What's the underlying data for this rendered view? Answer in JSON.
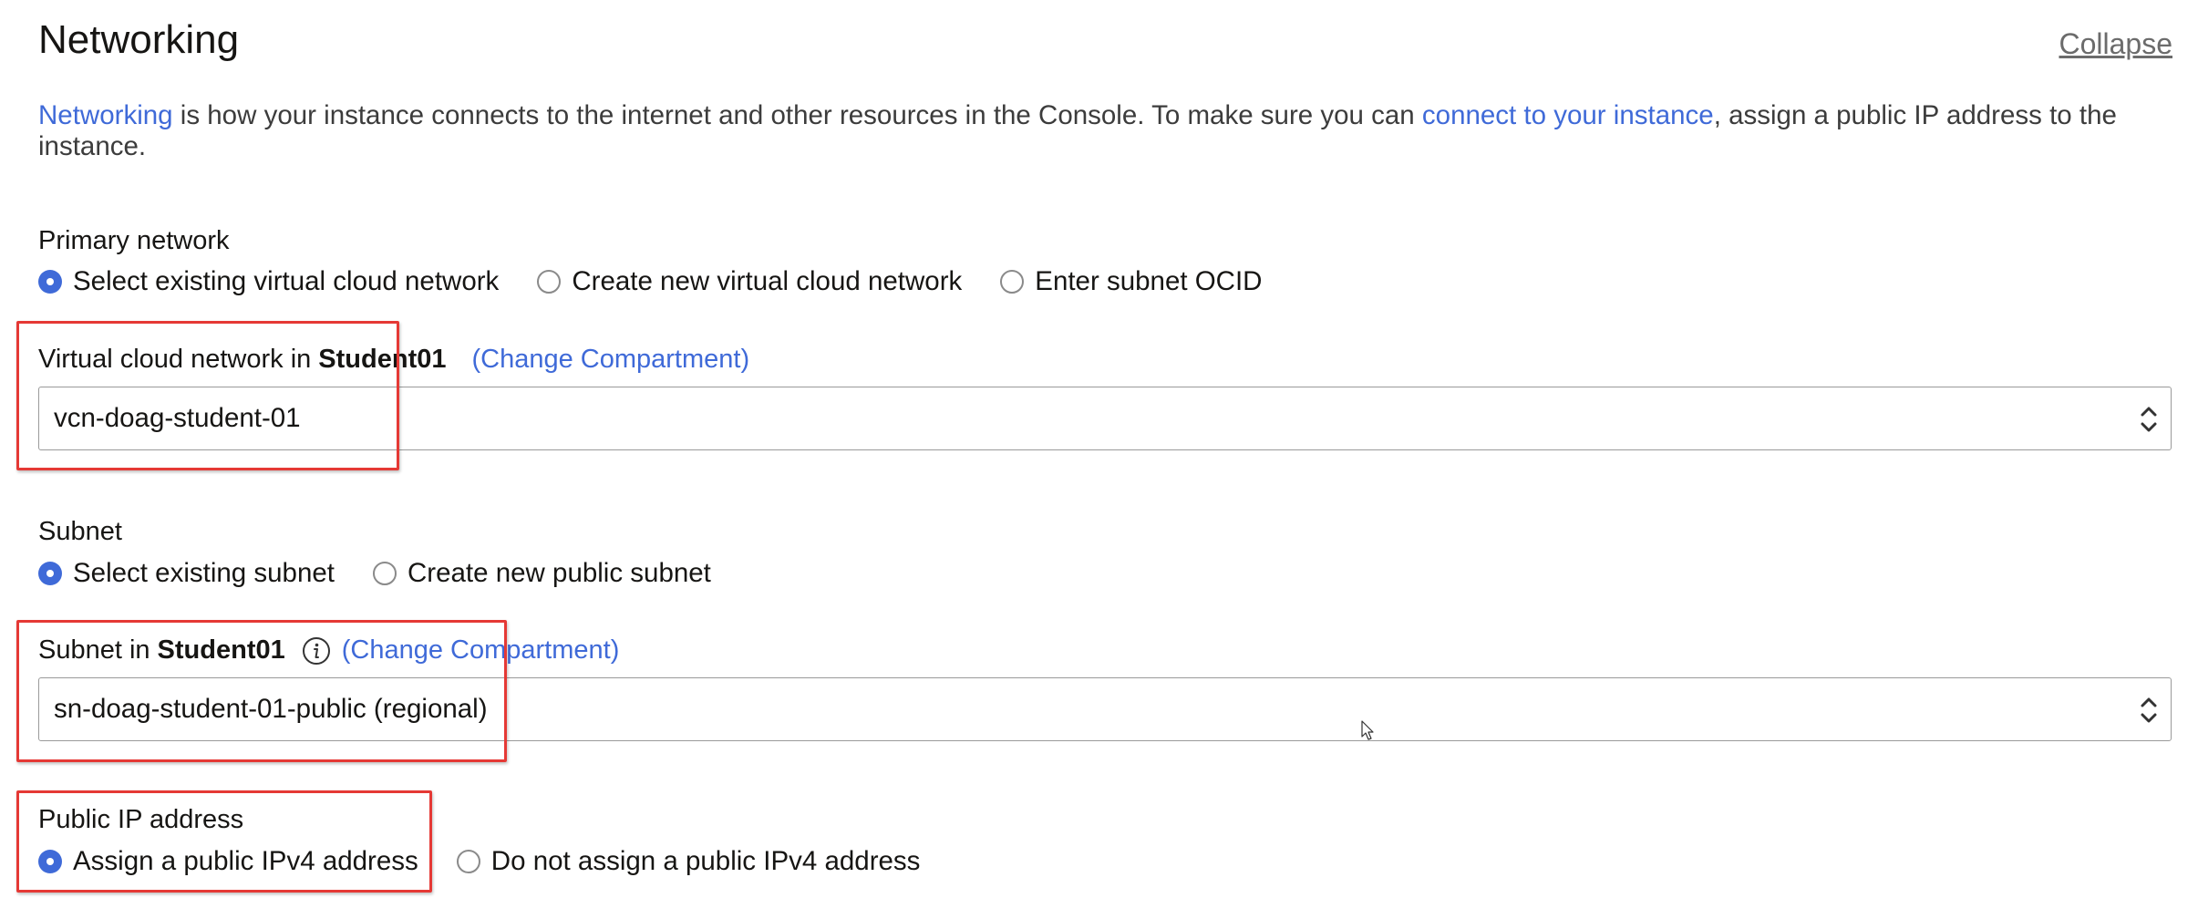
{
  "section": {
    "title": "Networking",
    "collapse_label": "Collapse"
  },
  "intro": {
    "link1": "Networking",
    "text1": " is how your instance connects to the internet and other resources in the Console. To make sure you can ",
    "link2": "connect to your instance",
    "text2": ", assign a public IP address to the instance."
  },
  "primary_network": {
    "label": "Primary network",
    "options": [
      {
        "label": "Select existing virtual cloud network",
        "selected": true
      },
      {
        "label": "Create new virtual cloud network",
        "selected": false
      },
      {
        "label": "Enter subnet OCID",
        "selected": false
      }
    ]
  },
  "vcn": {
    "label_prefix": "Virtual cloud network in",
    "compartment": "Student01",
    "change_link": "(Change Compartment)",
    "value": "vcn-doag-student-01",
    "chevron_icon": "chevron-updown-icon"
  },
  "subnet_type": {
    "label": "Subnet",
    "options": [
      {
        "label": "Select existing subnet",
        "selected": true
      },
      {
        "label": "Create new public subnet",
        "selected": false
      }
    ]
  },
  "subnet": {
    "label_prefix": "Subnet in",
    "compartment": "Student01",
    "info_icon": "info-icon",
    "change_link": "(Change Compartment)",
    "value": "sn-doag-student-01-public (regional)",
    "chevron_icon": "chevron-updown-icon"
  },
  "public_ip": {
    "label": "Public IP address",
    "options": [
      {
        "label": "Assign a public IPv4 address",
        "selected": true
      },
      {
        "label": "Do not assign a public IPv4 address",
        "selected": false
      }
    ]
  },
  "colors": {
    "link": "#3f6ad8",
    "radio_selected": "#3f6ad8",
    "highlight": "#e53935"
  }
}
